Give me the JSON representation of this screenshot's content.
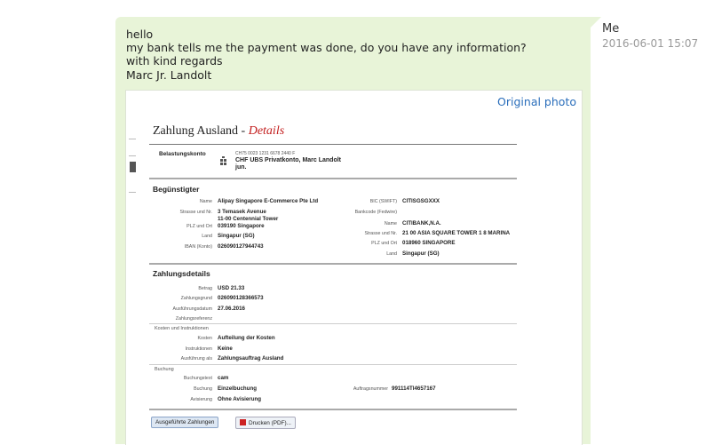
{
  "message": {
    "lines": [
      "hello",
      "my bank tells me the payment was done, do you have any information?",
      "with kind regards",
      "Marc Jr. Landolt"
    ],
    "sender": "Me",
    "timestamp": "2016-06-01 15:07",
    "original_photo_link": "Original photo"
  },
  "photo": {
    "title_main": "Zahlung Ausland",
    "title_sep": " - ",
    "title_detail": "Details",
    "debit": {
      "label": "Belastungskonto",
      "account_no": "CH75 0023 1231 6678 2440 F",
      "account_name": "CHF UBS Privatkonto, Marc Landolt",
      "account_name2": "jun."
    },
    "beneficiary": {
      "heading": "Begünstigter",
      "left": [
        {
          "label": "Name",
          "value": "Alipay Singapore E-Commerce Pte Ltd"
        },
        {
          "label": "Strasse und Nr.",
          "value": "3 Temasek Avenue"
        },
        {
          "label": "",
          "value": "11-00 Centennial Tower"
        },
        {
          "label": "PLZ und Ort",
          "value": "039190 Singapore"
        },
        {
          "label": "Land",
          "value": "Singapur (SG)"
        },
        {
          "label": "IBAN (Konto)",
          "value": "026090127944743"
        }
      ],
      "right": [
        {
          "label": "BIC (SWIFT)",
          "value": "CITISGSGXXX"
        },
        {
          "label": "Bankcode (Fedwire)",
          "value": ""
        },
        {
          "label": "Name",
          "value": "CITIBANK,N.A."
        },
        {
          "label": "Strasse und Nr.",
          "value": "21 00 ASIA SQUARE TOWER 1 8 MARINA"
        },
        {
          "label": "PLZ und Ort",
          "value": "018960 SINGAPORE"
        },
        {
          "label": "Land",
          "value": "Singapur (SG)"
        }
      ]
    },
    "payment": {
      "heading": "Zahlungsdetails",
      "rows": [
        {
          "label": "Betrag",
          "value": "USD   21.33"
        },
        {
          "label": "Zahlungsgrund",
          "value": "026090128366573"
        },
        {
          "label": "Ausführungsdatum",
          "value": "27.06.2016"
        },
        {
          "label": "Zahlungsreferenz",
          "value": ""
        }
      ],
      "costs_heading": "Kosten und Instruktionen",
      "costs_rows": [
        {
          "label": "Kosten",
          "value": "Aufteilung der Kosten"
        },
        {
          "label": "Instruktionen",
          "value": "Keine"
        },
        {
          "label": "Ausführung als",
          "value": "Zahlungsauftrag Ausland"
        }
      ],
      "booking_heading": "Buchung",
      "booking_rows": [
        {
          "label": "Buchungstext",
          "value": "cam"
        },
        {
          "label": "Buchung",
          "value": "Einzelbuchung"
        },
        {
          "label": "Avisierung",
          "value": "Ohne Avisierung"
        }
      ],
      "order_label": "Auftragsnummer",
      "order_value": "991114TI4657167"
    },
    "buttons": {
      "executed": "Ausgeführte Zahlungen",
      "print": "Drucken (PDF)..."
    }
  }
}
